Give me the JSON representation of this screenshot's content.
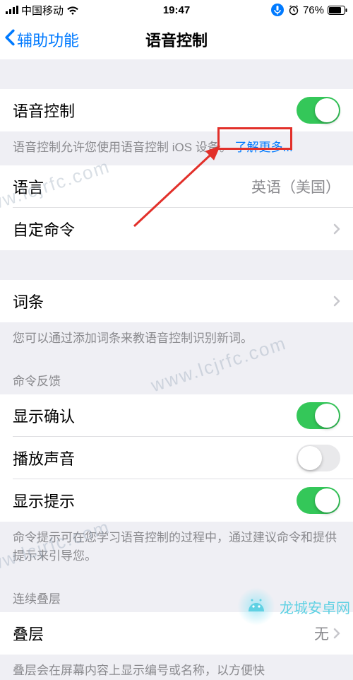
{
  "status_bar": {
    "carrier": "中国移动",
    "time": "19:47",
    "battery_pct": "76%"
  },
  "nav": {
    "back_label": "辅助功能",
    "title": "语音控制"
  },
  "section_voice": {
    "row_label": "语音控制",
    "toggle_on": true,
    "footer_text": "语音控制允许您使用语音控制 iOS 设备。",
    "footer_link": "了解更多..."
  },
  "section_lang_cmd": {
    "language_label": "语言",
    "language_value": "英语（美国）",
    "custom_cmd_label": "自定命令"
  },
  "section_terms": {
    "terms_label": "词条",
    "footer": "您可以通过添加词条来教语音控制识别新词。"
  },
  "section_feedback": {
    "header": "命令反馈",
    "show_confirm_label": "显示确认",
    "show_confirm_on": true,
    "play_sound_label": "播放声音",
    "play_sound_on": false,
    "show_hints_label": "显示提示",
    "show_hints_on": true,
    "footer": "命令提示可在您学习语音控制的过程中，通过建议命令和提供提示来引导您。"
  },
  "section_overlay": {
    "header": "连续叠层",
    "row_label": "叠层",
    "row_value": "无",
    "footer": "叠层会在屏幕内容上显示编号或名称，以方便快"
  },
  "watermark": {
    "text": "www.lcjrfc.com",
    "brand": "龙城安卓网"
  }
}
